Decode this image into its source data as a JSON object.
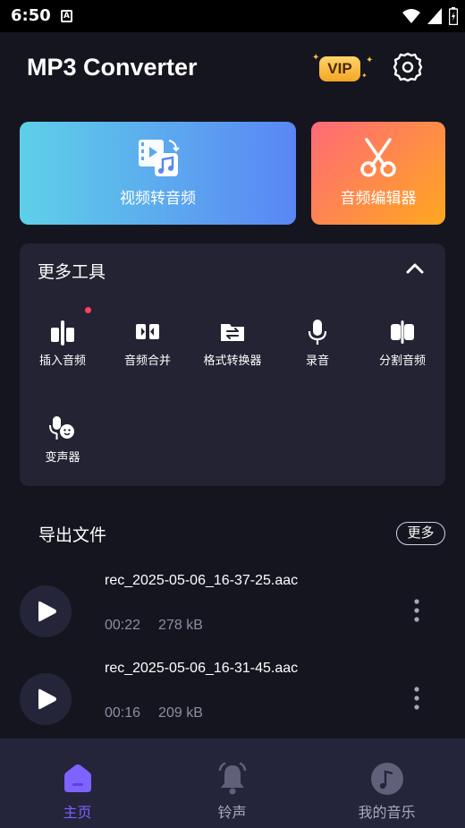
{
  "status_bar": {
    "time": "6:50",
    "notif_letter": "A"
  },
  "header": {
    "title": "MP3 Converter",
    "vip_label": "VIP"
  },
  "feature_cards": [
    {
      "label": "视频转音频",
      "icon": "video-music-icon"
    },
    {
      "label": "音频编辑器",
      "icon": "scissors-icon"
    }
  ],
  "more_tools": {
    "title": "更多工具",
    "tools": [
      {
        "label": "插入音频",
        "icon": "insert-audio-icon"
      },
      {
        "label": "音频合并",
        "icon": "merge-audio-icon"
      },
      {
        "label": "格式转换器",
        "icon": "format-convert-icon"
      },
      {
        "label": "录音",
        "icon": "microphone-icon"
      },
      {
        "label": "分割音频",
        "icon": "split-audio-icon"
      },
      {
        "label": "变声器",
        "icon": "voice-changer-icon"
      }
    ]
  },
  "exports": {
    "title": "导出文件",
    "more_label": "更多",
    "files": [
      {
        "name": "rec_2025-05-06_16-37-25.aac",
        "duration": "00:22",
        "size": "278 kB"
      },
      {
        "name": "rec_2025-05-06_16-31-45.aac",
        "duration": "00:16",
        "size": "209 kB"
      }
    ]
  },
  "bottom_nav": {
    "items": [
      {
        "label": "主页",
        "icon": "home-icon",
        "active": true
      },
      {
        "label": "铃声",
        "icon": "bell-icon",
        "active": false
      },
      {
        "label": "我的音乐",
        "icon": "music-disc-icon",
        "active": false
      }
    ]
  },
  "colors": {
    "background": "#15151f",
    "panel": "#232333",
    "accent": "#7f62ff",
    "muted": "#8d8da3",
    "vip_gold": "#f5a623"
  }
}
